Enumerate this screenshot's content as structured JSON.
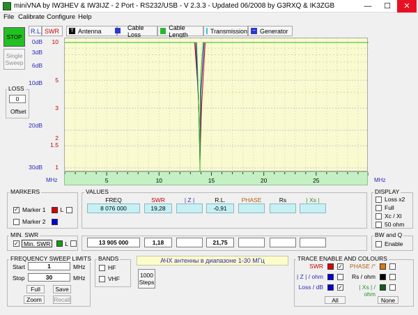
{
  "window": {
    "title": "miniVNA by IW3HEV & IW3IJZ - 2 Port - RS232/USB - V 2.3.3 - Updated 06/2008 by G3RXQ & IK3ZGB",
    "minimize": "—",
    "maximize": "☐",
    "close": "✕"
  },
  "menu": [
    "File",
    "Calibrate",
    "Configure",
    "Help"
  ],
  "left": {
    "stop": "STOP",
    "single_sweep": "Single Sweep",
    "loss_title": "LOSS",
    "loss_value": "0",
    "offset": "Offset"
  },
  "tabs": {
    "rl": "R.L.",
    "swr": "SWR",
    "antenna": "Antenna",
    "cable_loss": "Cable Loss",
    "cable_length": "Cable Length",
    "transmission": "Transmission",
    "generator": "Generator"
  },
  "chart_data": {
    "type": "line",
    "title": "",
    "xlabel": "MHz",
    "ylabel": "",
    "xlim": [
      1,
      30
    ],
    "x_ticks": [
      "5",
      "10",
      "15",
      "20",
      "25"
    ],
    "rl_ticks": [
      "0dB",
      "3dB",
      "6dB",
      "10dB",
      "20dB",
      "30dB"
    ],
    "swr_ticks": [
      "10",
      "5",
      "3",
      "2",
      "1.5",
      "1"
    ],
    "swr_tick_values": [
      10,
      5,
      3,
      2,
      1.5,
      1
    ],
    "grid": true,
    "series": [
      {
        "color": "#cc0000",
        "x": [
          1,
          13.4,
          13.75,
          13.905,
          14.05,
          14.4,
          30
        ],
        "y": [
          10,
          10,
          4,
          1.18,
          3,
          10,
          10
        ]
      },
      {
        "color": "#0000cc",
        "x": [
          1,
          13.5,
          13.8,
          13.905,
          14.0,
          14.3,
          30
        ],
        "y": [
          10,
          10,
          3,
          1.1,
          4,
          10,
          10
        ]
      },
      {
        "color": "#2ab82a",
        "x": [
          1,
          13.6,
          13.85,
          13.905,
          13.95,
          14.2,
          30
        ],
        "y": [
          10,
          10,
          2,
          1,
          5,
          10,
          10
        ]
      }
    ],
    "marker_freq": 13.905
  },
  "markers": {
    "title": "MARKERS",
    "marker1": "Marker 1",
    "marker2": "Marker 2",
    "l": "L"
  },
  "values": {
    "title": "VALUES",
    "headers": [
      "FREQ",
      "SWR",
      "| Z |",
      "R.L.",
      "PHASE",
      "Rs",
      "| Xs |"
    ],
    "header_colors": [
      "#000000",
      "#c00000",
      "#2a2ab8",
      "#000000",
      "#b06010",
      "#000000",
      "#2a8a2a"
    ],
    "row1": [
      "8 076 000",
      "19,28",
      "",
      "-0,91",
      "",
      "",
      ""
    ],
    "row2": [
      "13 905 000",
      "1,18",
      "",
      "21,75",
      "",
      "",
      ""
    ]
  },
  "min_swr": {
    "title": "MIN. SWR",
    "button": "Min. SWR",
    "l": "L"
  },
  "display": {
    "title": "DISPLAY",
    "options": [
      "Loss x2",
      "Full",
      "Xc / Xl",
      "50 ohm"
    ]
  },
  "bwq": {
    "title": "BW and Q",
    "enable": "Enable"
  },
  "sweep": {
    "title": "FREQUENCY SWEEP LIMITS",
    "start_label": "Start",
    "start_value": "1",
    "stop_label": "Stop",
    "stop_value": "30",
    "unit": "MHz",
    "full": "Full",
    "save": "Save",
    "zoom": "Zoom",
    "recall": "Recall"
  },
  "bands": {
    "title": "BANDS",
    "hf": "HF",
    "vhf": "VHF"
  },
  "steps": {
    "value": "1000",
    "label": "Steps"
  },
  "note": "АЧХ антенны в диапазоне 1-30 МГц",
  "trace": {
    "title": "TRACE ENABLE AND COLOURS",
    "swr": "SWR",
    "z": "| Z | / ohm",
    "loss": "Loss / dB",
    "phase": "PHASE /°",
    "rs": "Rs / ohm",
    "xs": "| Xs | / ohm",
    "all": "All",
    "none": "None"
  },
  "colors": {
    "red": "#dd0000",
    "blue": "#0000dd",
    "green": "#11a011",
    "orange": "#e07810",
    "black": "#000000",
    "dkgreen": "#106010",
    "stop_green": "#22c022"
  }
}
